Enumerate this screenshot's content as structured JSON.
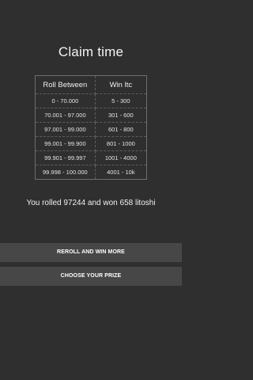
{
  "screen": {
    "title": "Claim time"
  },
  "prize_table": {
    "headers": [
      "Roll Between",
      "Win ltc"
    ],
    "rows": [
      [
        "0 - 70.000",
        "5 - 300"
      ],
      [
        "70.001 - 97.000",
        "301 - 600"
      ],
      [
        "97.001 - 99.000",
        "601 - 800"
      ],
      [
        "99.001 - 99.900",
        "801 - 1000"
      ],
      [
        "99.901 - 99.997",
        "1001 - 4000"
      ],
      [
        "99.998 - 100.000",
        "4001 - 10k"
      ]
    ]
  },
  "result": {
    "message": "You rolled 97244 and won 658 litoshi"
  },
  "actions": {
    "reroll_label": "REROLL AND WIN MORE",
    "choose_prize_label": "CHOOSE YOUR PRIZE"
  },
  "colors": {
    "background": "#2f2f2f",
    "button": "#474747",
    "text": "#f2f2f2"
  }
}
